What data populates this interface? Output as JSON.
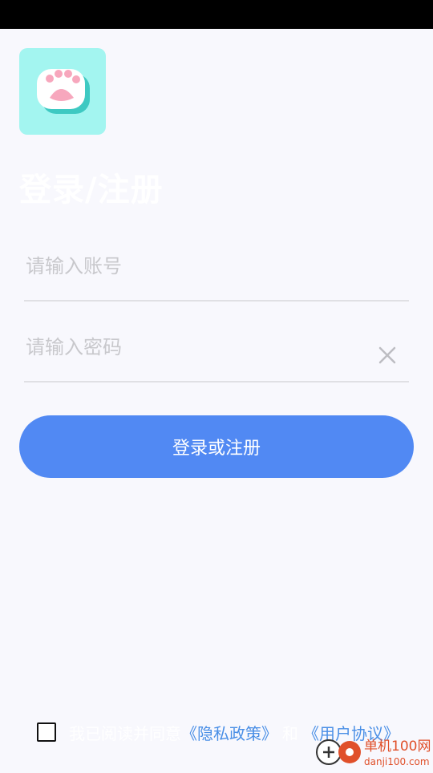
{
  "title": "登录/注册",
  "account": {
    "placeholder": "请输入账号"
  },
  "password": {
    "placeholder": "请输入密码"
  },
  "login_button": "登录或注册",
  "agreement": {
    "prefix": "我已阅读并同意",
    "privacy_link": "《隐私政策》",
    "joiner": "和",
    "terms_link": "《用户协议》",
    "checked": false
  },
  "watermark": {
    "line1": "单机100网",
    "line2": "danji100.com"
  },
  "colors": {
    "accent": "#5189f3",
    "logo_bg": "#a3f5f0",
    "link": "#4a8fe6",
    "watermark": "#e0502a"
  },
  "icons": {
    "logo": "paw-icon",
    "clear": "close-icon",
    "watermark": "danji-logo-icon"
  }
}
